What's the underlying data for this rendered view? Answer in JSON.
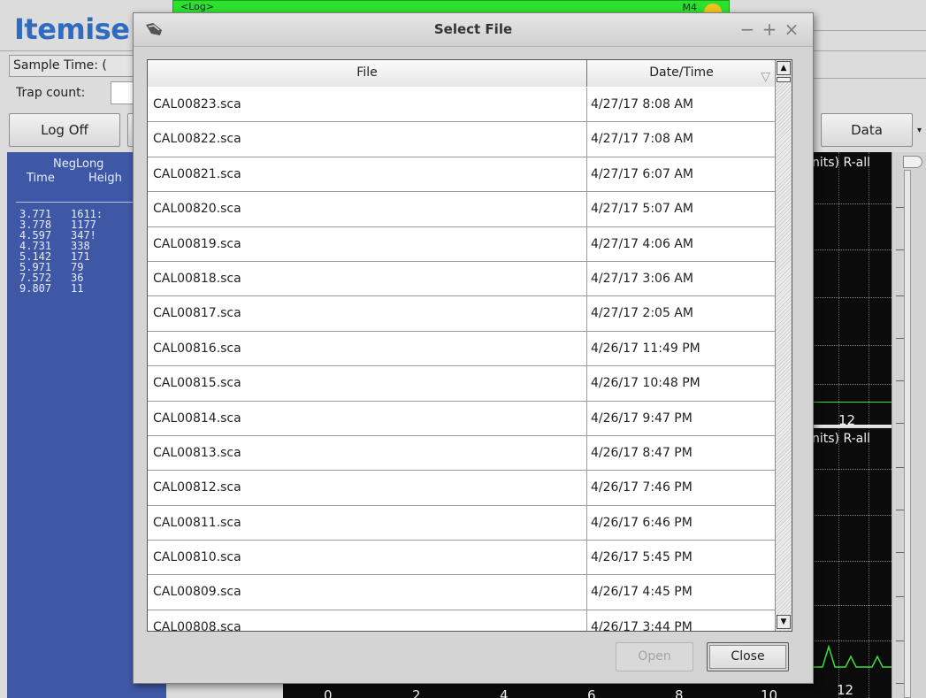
{
  "app": {
    "title": "Itemise",
    "log_label": "<Log>",
    "log_count": "M4",
    "sample_time_label": "Sample Time: (",
    "trap_count_label": "Trap count:",
    "log_off_button": "Log Off",
    "data_button": "Data",
    "neg_panel": {
      "title": "NegLong",
      "col_time": "Time",
      "col_height": "Heigh",
      "rows": [
        {
          "time": "3.771",
          "height": "1611:"
        },
        {
          "time": "3.778",
          "height": "1177"
        },
        {
          "time": "4.597",
          "height": "347!"
        },
        {
          "time": "4.731",
          "height": "338"
        },
        {
          "time": "5.142",
          "height": "171"
        },
        {
          "time": "5.971",
          "height": "79"
        },
        {
          "time": "7.572",
          "height": "36"
        },
        {
          "time": "9.807",
          "height": "11"
        }
      ]
    },
    "graph_top_label": "nits) R-all",
    "graph_bottom_label": "nits) R-all",
    "graph_top_tick": "12",
    "x_ticks": [
      "0",
      "2",
      "4",
      "6",
      "8",
      "10",
      "12"
    ]
  },
  "dialog": {
    "title": "Select File",
    "columns": {
      "file": "File",
      "datetime": "Date/Time"
    },
    "rows": [
      {
        "file": "CAL00823.sca",
        "datetime": "4/27/17 8:08 AM"
      },
      {
        "file": "CAL00822.sca",
        "datetime": "4/27/17 7:08 AM"
      },
      {
        "file": "CAL00821.sca",
        "datetime": "4/27/17 6:07 AM"
      },
      {
        "file": "CAL00820.sca",
        "datetime": "4/27/17 5:07 AM"
      },
      {
        "file": "CAL00819.sca",
        "datetime": "4/27/17 4:06 AM"
      },
      {
        "file": "CAL00818.sca",
        "datetime": "4/27/17 3:06 AM"
      },
      {
        "file": "CAL00817.sca",
        "datetime": "4/27/17 2:05 AM"
      },
      {
        "file": "CAL00816.sca",
        "datetime": "4/26/17 11:49 PM"
      },
      {
        "file": "CAL00815.sca",
        "datetime": "4/26/17 10:48 PM"
      },
      {
        "file": "CAL00814.sca",
        "datetime": "4/26/17 9:47 PM"
      },
      {
        "file": "CAL00813.sca",
        "datetime": "4/26/17 8:47 PM"
      },
      {
        "file": "CAL00812.sca",
        "datetime": "4/26/17 7:46 PM"
      },
      {
        "file": "CAL00811.sca",
        "datetime": "4/26/17 6:46 PM"
      },
      {
        "file": "CAL00810.sca",
        "datetime": "4/26/17 5:45 PM"
      },
      {
        "file": "CAL00809.sca",
        "datetime": "4/26/17 4:45 PM"
      },
      {
        "file": "CAL00808.sca",
        "datetime": "4/26/17 3:44 PM"
      }
    ],
    "open_button": "Open",
    "close_button": "Close",
    "window_controls": {
      "minimize": "−",
      "maximize": "+",
      "close": "×"
    }
  },
  "colors": {
    "app_title": "#2f6cc0",
    "log_strip": "#2de02d",
    "neg_panel": "#3f58a6",
    "graph_bg": "#0b0b0b",
    "graph_trace": "#3fdc3f"
  }
}
